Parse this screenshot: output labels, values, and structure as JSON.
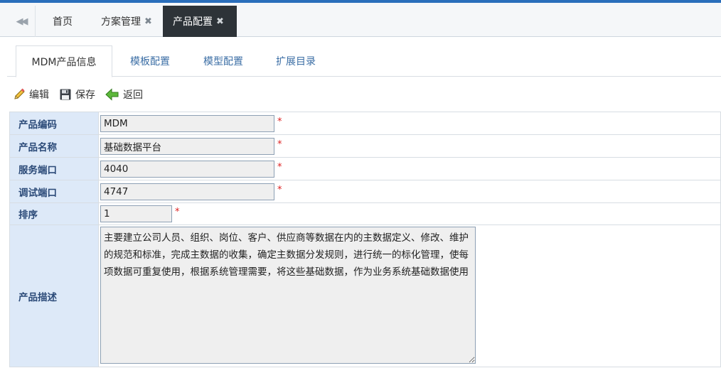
{
  "main_tabs": {
    "items": [
      {
        "label": "首页",
        "closable": false
      },
      {
        "label": "方案管理",
        "closable": true
      },
      {
        "label": "产品配置",
        "closable": true,
        "active": true
      }
    ],
    "close_glyph": "✖"
  },
  "sub_tabs": [
    "MDM产品信息",
    "模板配置",
    "模型配置",
    "扩展目录"
  ],
  "toolbar": {
    "edit_label": "编辑",
    "save_label": "保存",
    "back_label": "返回"
  },
  "form": {
    "required_mark": "*",
    "product_code": {
      "label": "产品编码",
      "value": "MDM"
    },
    "product_name": {
      "label": "产品名称",
      "value": "基础数据平台"
    },
    "service_port": {
      "label": "服务端口",
      "value": "4040"
    },
    "debug_port": {
      "label": "调试端口",
      "value": "4747"
    },
    "sort": {
      "label": "排序",
      "value": "1"
    },
    "description": {
      "label": "产品描述",
      "value": "主要建立公司人员、组织、岗位、客户、供应商等数据在内的主数据定义、修改、维护的规范和标准，完成主数据的收集，确定主数据分发规则，进行统一的标化管理，使每项数据可重复使用，根据系统管理需要，将这些基础数据，作为业务系统基础数据使用"
    }
  },
  "colors": {
    "accent": "#2a6ebb",
    "active_tab_bg": "#2d3338",
    "label_bg": "#dde9f8",
    "required": "#dd2222"
  }
}
